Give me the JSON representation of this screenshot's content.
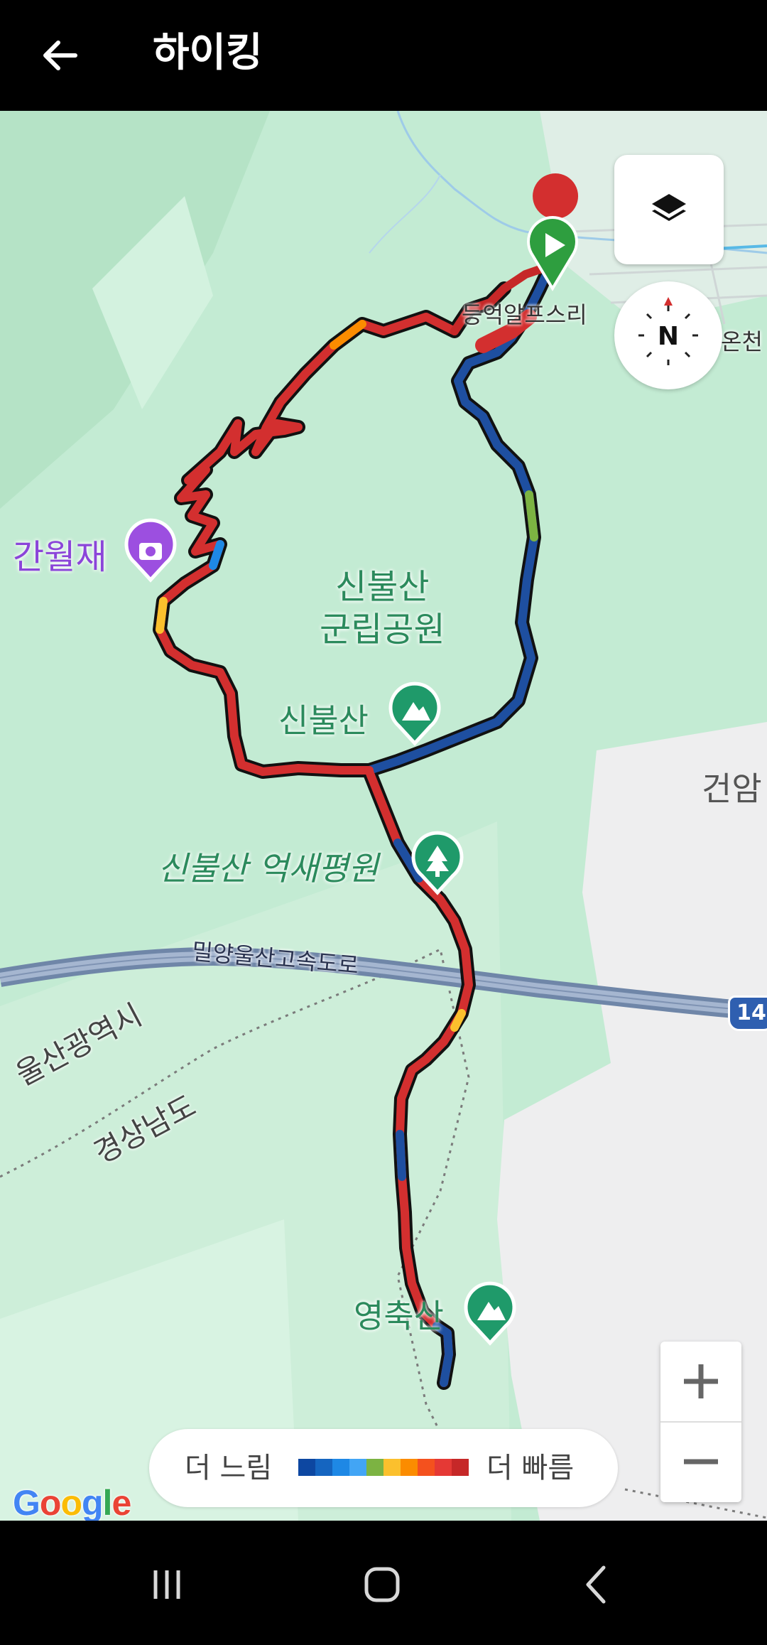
{
  "header": {
    "title": "하이킹",
    "back_icon": "arrow-left-icon"
  },
  "map": {
    "park_label_line1": "신불산",
    "park_label_line2": "군립공원",
    "peak_sinbulsan": "신불산",
    "forest_eoksaepyeongwon": "신불산 억새평원",
    "viewpoint_ganwoljae": "간월재",
    "place_deungeok": "등억알프스리",
    "place_oncheon": "온천",
    "place_geonam": "건암",
    "peak_yeongchuksan": "영축산",
    "highway_label": "밀양울산고속도로",
    "highway_shield": "14",
    "region_ulsan": "울산광역시",
    "region_gyeongnam": "경상남도",
    "attribution": "Google"
  },
  "controls": {
    "layers_icon": "layers-icon",
    "compass_letter": "N",
    "zoom_in_icon": "plus-icon",
    "zoom_out_icon": "minus-icon"
  },
  "legend": {
    "slow_label": "더 느림",
    "fast_label": "더 빠름",
    "colors": [
      "#0d47a1",
      "#1565c0",
      "#1e88e5",
      "#42a5f5",
      "#7cb342",
      "#fbc02d",
      "#fb8c00",
      "#f4511e",
      "#e53935",
      "#c62828"
    ]
  },
  "route_colors": {
    "main": "#d32f2f",
    "alt": "#1e4fa0",
    "outline": "#111111"
  },
  "navbar": {
    "recent_icon": "recent-apps-icon",
    "home_icon": "home-icon",
    "back_icon": "back-nav-icon"
  }
}
